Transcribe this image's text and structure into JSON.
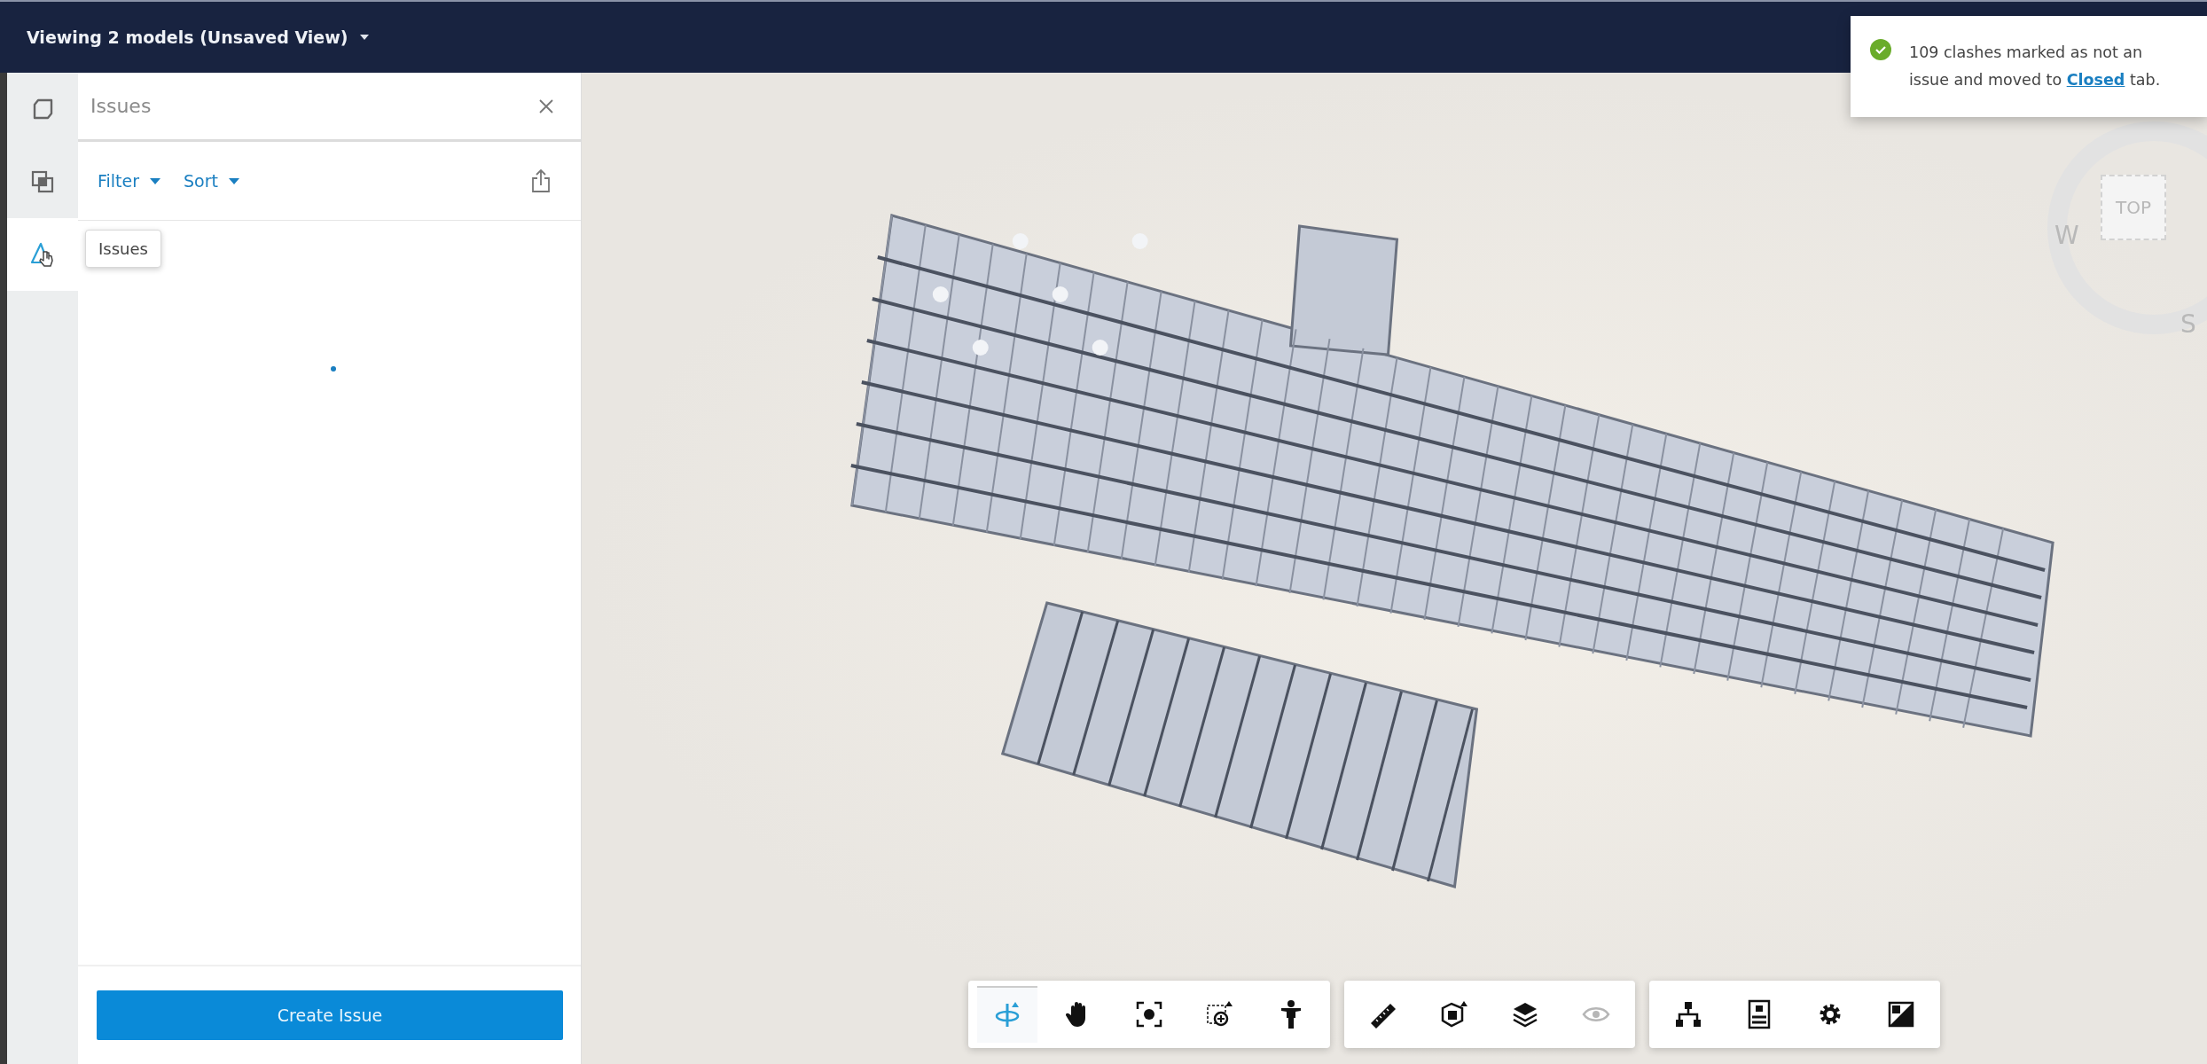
{
  "header": {
    "title": "Viewing 2 models (Unsaved View)"
  },
  "rail": [
    {
      "kind": "cube",
      "selected": false
    },
    {
      "kind": "models",
      "selected": false
    },
    {
      "kind": "issues",
      "selected": true
    }
  ],
  "tooltip": "Issues",
  "panel": {
    "title": "Issues",
    "filters": [
      "Filter",
      "Sort"
    ],
    "button": "Create Issue"
  },
  "toast": {
    "before": "109 clashes marked as not an issue and moved to ",
    "link": "Closed",
    "after": " tab."
  },
  "compass": {
    "top": "TOP",
    "west": "W",
    "south": "S"
  },
  "toolbar": [
    {
      "tools": [
        {
          "kind": "orbit",
          "selected": true,
          "disabled": false
        },
        {
          "kind": "pan",
          "selected": false,
          "disabled": false
        },
        {
          "kind": "fit",
          "selected": false,
          "disabled": false
        },
        {
          "kind": "zoom",
          "selected": false,
          "disabled": false
        },
        {
          "kind": "walk",
          "selected": false,
          "disabled": false
        }
      ]
    },
    {
      "tools": [
        {
          "kind": "measure",
          "selected": false,
          "disabled": false
        },
        {
          "kind": "section",
          "selected": false,
          "disabled": false
        },
        {
          "kind": "layers",
          "selected": false,
          "disabled": false
        },
        {
          "kind": "visibility",
          "selected": false,
          "disabled": true
        }
      ]
    },
    {
      "tools": [
        {
          "kind": "tree",
          "selected": false,
          "disabled": false
        },
        {
          "kind": "properties",
          "selected": false,
          "disabled": false
        },
        {
          "kind": "settings",
          "selected": false,
          "disabled": false
        },
        {
          "kind": "fullscreen",
          "selected": false,
          "disabled": false
        }
      ]
    }
  ]
}
